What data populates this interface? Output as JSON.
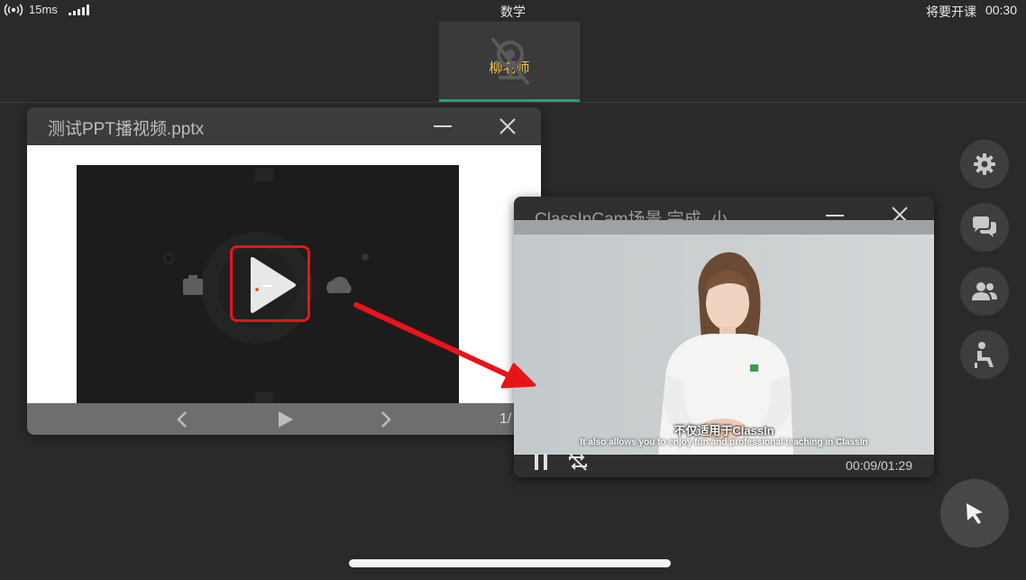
{
  "status_bar": {
    "latency": "15ms",
    "course": "数学",
    "class_status": "将要开课",
    "time": "00:30"
  },
  "teacher": {
    "name": "柳老师"
  },
  "ppt_window": {
    "title": "测试PPT播视频.pptx",
    "page_number": "1/"
  },
  "video_window": {
    "title": "ClassInCam场景 完成_小",
    "subtitle_cn": "不仅适用于ClassIn",
    "subtitle_en": "It also allows you to enjoy fun and professional teaching in ClassIn",
    "time": "00:09/01:29",
    "progress": 0.1
  },
  "colors": {
    "accent_green": "#2eae6c",
    "teacher_name": "#f0c24a",
    "annotation_red": "#e8141a"
  }
}
